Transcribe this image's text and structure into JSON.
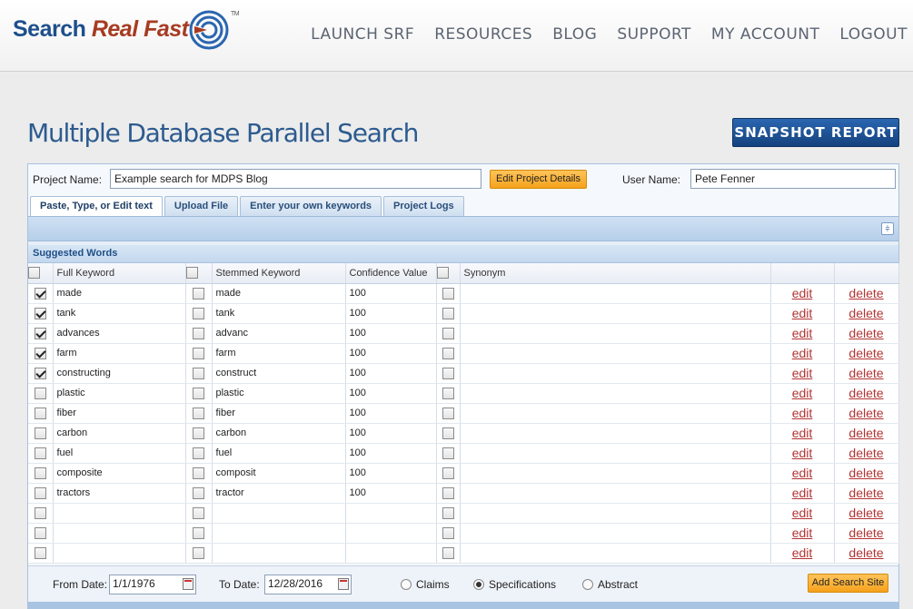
{
  "brand": {
    "part1": "Search",
    "part2": "Real Fast",
    "tm": "TM"
  },
  "nav": [
    "LAUNCH SRF",
    "RESOURCES",
    "BLOG",
    "SUPPORT",
    "MY ACCOUNT",
    "LOGOUT"
  ],
  "page_title": "Multiple Database Parallel Search",
  "snapshot_label": "SNAPSHOT REPORT",
  "project": {
    "name_label": "Project Name:",
    "name_value": "Example search for MDPS Blog",
    "edit_label": "Edit Project Details",
    "user_label": "User Name:",
    "user_value": "Pete Fenner"
  },
  "tabs": [
    "Paste, Type, or Edit text",
    "Upload File",
    "Enter your own keywords",
    "Project Logs"
  ],
  "suggested_title": "Suggested Words",
  "columns": {
    "full": "Full Keyword",
    "stemmed": "Stemmed Keyword",
    "confidence": "Confidence Value",
    "synonym": "Synonym"
  },
  "actions": {
    "edit": "edit",
    "delete": "delete"
  },
  "rows": [
    {
      "checked": true,
      "full": "made",
      "stemmed": "made",
      "confidence": "100"
    },
    {
      "checked": true,
      "full": "tank",
      "stemmed": "tank",
      "confidence": "100"
    },
    {
      "checked": true,
      "full": "advances",
      "stemmed": "advanc",
      "confidence": "100"
    },
    {
      "checked": true,
      "full": "farm",
      "stemmed": "farm",
      "confidence": "100"
    },
    {
      "checked": true,
      "full": "constructing",
      "stemmed": "construct",
      "confidence": "100"
    },
    {
      "checked": false,
      "full": "plastic",
      "stemmed": "plastic",
      "confidence": "100"
    },
    {
      "checked": false,
      "full": "fiber",
      "stemmed": "fiber",
      "confidence": "100"
    },
    {
      "checked": false,
      "full": "carbon",
      "stemmed": "carbon",
      "confidence": "100"
    },
    {
      "checked": false,
      "full": "fuel",
      "stemmed": "fuel",
      "confidence": "100"
    },
    {
      "checked": false,
      "full": "composite",
      "stemmed": "composit",
      "confidence": "100"
    },
    {
      "checked": false,
      "full": "tractors",
      "stemmed": "tractor",
      "confidence": "100"
    },
    {
      "checked": false,
      "full": "",
      "stemmed": "",
      "confidence": ""
    },
    {
      "checked": false,
      "full": "",
      "stemmed": "",
      "confidence": ""
    },
    {
      "checked": false,
      "full": "",
      "stemmed": "",
      "confidence": ""
    }
  ],
  "dates": {
    "from_label": "From Date:",
    "from_value": "1/1/1976",
    "to_label": "To Date:",
    "to_value": "12/28/2016"
  },
  "scope": {
    "options": [
      "Claims",
      "Specifications",
      "Abstract"
    ],
    "selected": "Specifications"
  },
  "add_site_label": "Add Search Site",
  "colors": {
    "brand_blue": "#1e4f8c",
    "brand_red": "#a63b22",
    "accent_orange": "#f5a21c",
    "link_red": "#b23333"
  }
}
